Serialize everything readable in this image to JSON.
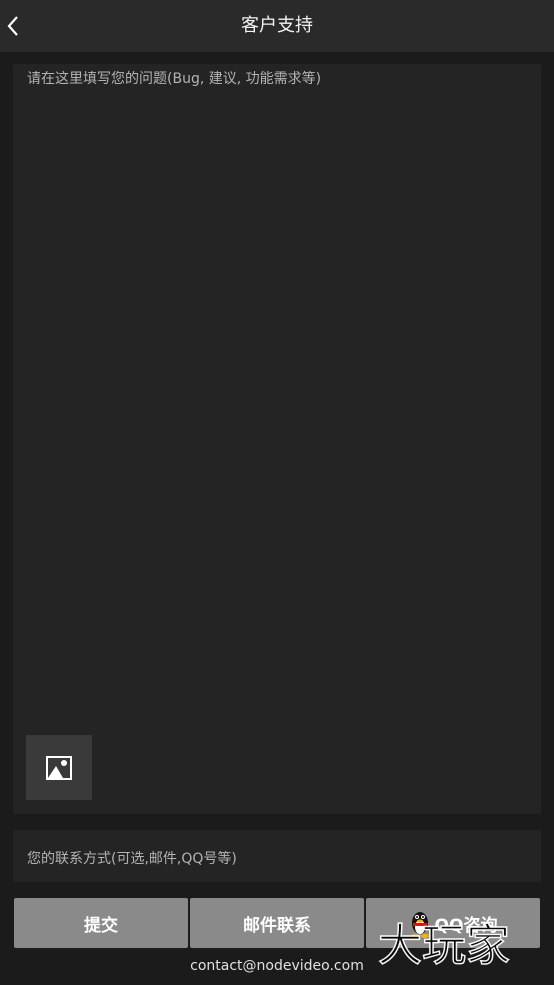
{
  "header": {
    "title": "客户支持"
  },
  "feedback": {
    "placeholder": "请在这里填写您的问题(Bug, 建议, 功能需求等)"
  },
  "contact": {
    "placeholder": "您的联系方式(可选,邮件,QQ号等)"
  },
  "buttons": {
    "submit": "提交",
    "email": "邮件联系",
    "qq": "QQ咨询"
  },
  "footer": {
    "email": "contact@nodevideo.com"
  },
  "watermark": "大玩家",
  "colors": {
    "background": "#1b1b1b",
    "button": "#8a8a8a",
    "input": "#242424",
    "topbar": "#2a2a2a"
  },
  "icons": [
    "back-chevron-icon",
    "add-image-icon",
    "qq-penguin-icon"
  ]
}
